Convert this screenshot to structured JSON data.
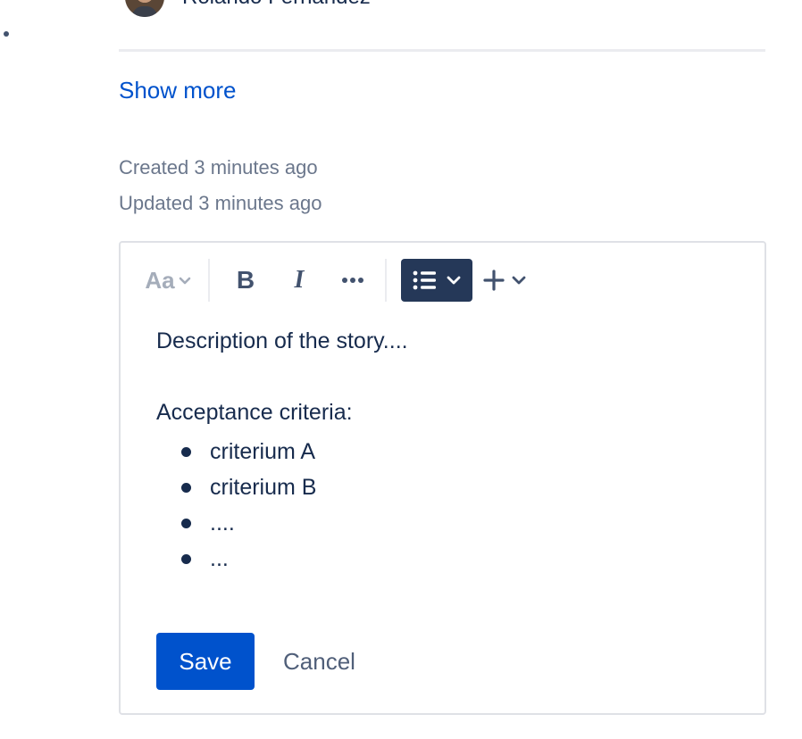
{
  "assignee": {
    "name": "Rolando Fernandez"
  },
  "show_more_label": "Show more",
  "meta": {
    "created": "Created 3 minutes ago",
    "updated": "Updated 3 minutes ago"
  },
  "editor": {
    "toolbar": {
      "text_style_label": "Aa",
      "bold_label": "B",
      "italic_label": "I",
      "more_icon": "more-horizontal-icon",
      "list_icon": "bullet-list-icon",
      "insert_icon": "plus-icon"
    },
    "content": {
      "paragraph_1": "Description of the story....",
      "paragraph_2": "Acceptance criteria:",
      "list_items": [
        "criterium A",
        "criterium B",
        "....",
        "..."
      ]
    },
    "save_label": "Save",
    "cancel_label": "Cancel"
  },
  "colors": {
    "primary": "#0052cc",
    "text": "#172b4d",
    "subtle_text": "#6b778c",
    "list_button_bg": "#253858",
    "border": "#dfe1e6"
  }
}
